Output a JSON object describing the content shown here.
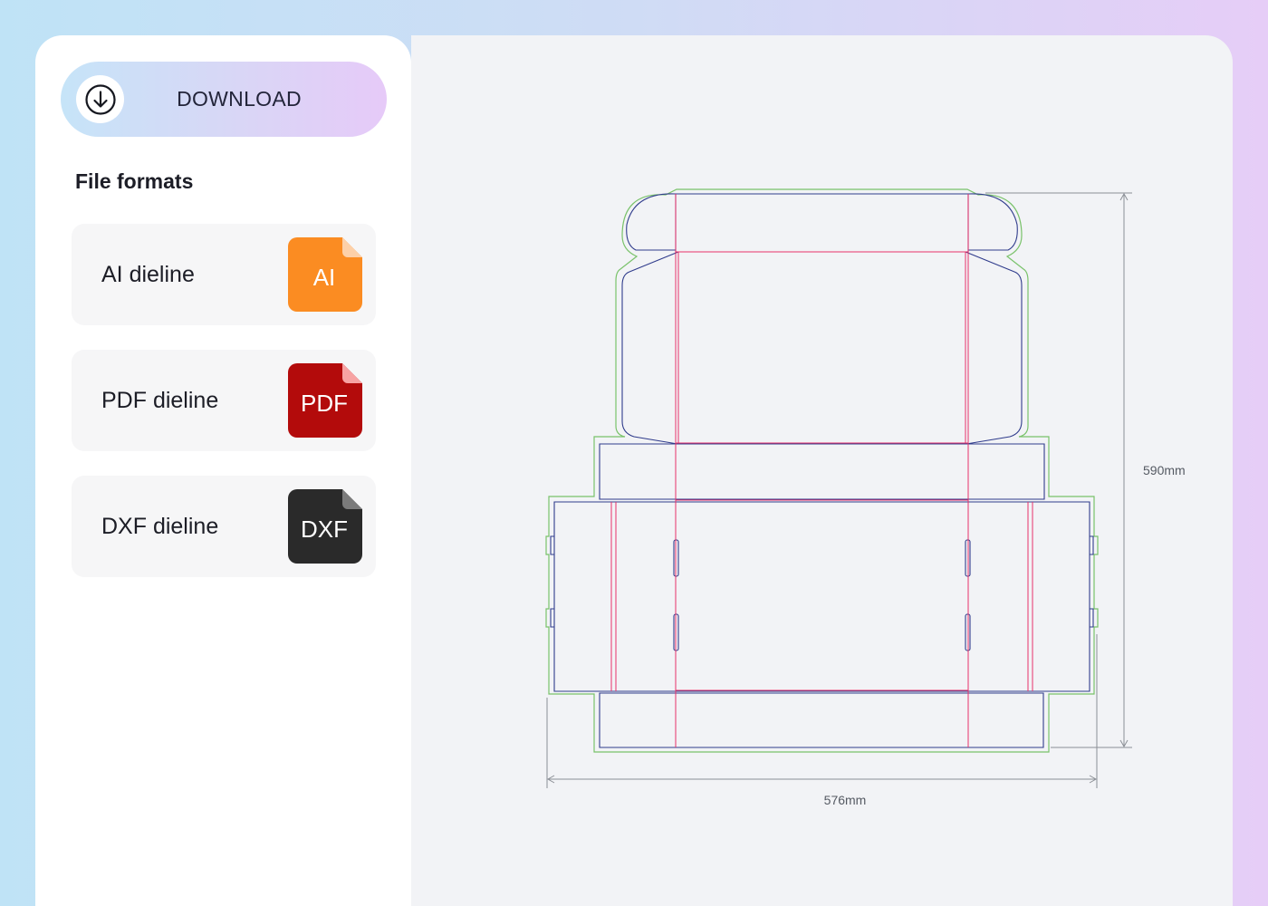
{
  "download": {
    "label": "DOWNLOAD",
    "icon": "download-arrow-icon"
  },
  "file_formats": {
    "title": "File formats",
    "items": [
      {
        "label": "AI dieline",
        "badge": "AI",
        "color": "#fb8c22",
        "fold_color": "#fdd0a8"
      },
      {
        "label": "PDF dieline",
        "badge": "PDF",
        "color": "#b30b0b",
        "fold_color": "#f7a3a3"
      },
      {
        "label": "DXF dieline",
        "badge": "DXF",
        "color": "#2a2a2a",
        "fold_color": "#7b7b7b"
      }
    ]
  },
  "dieline": {
    "width_label": "576mm",
    "height_label": "590mm",
    "colors": {
      "cut": "#303c8c",
      "fold": "#e8306a",
      "bleed": "#79c26a",
      "dimension": "#8b8f96"
    }
  }
}
